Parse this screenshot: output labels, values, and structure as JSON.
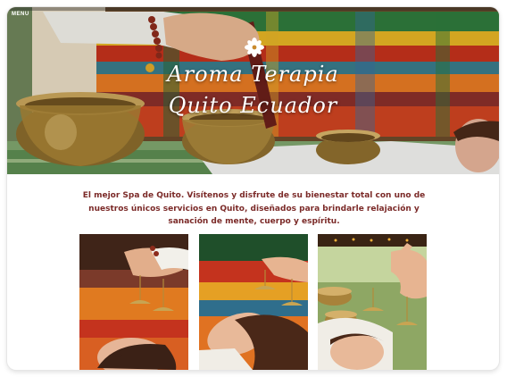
{
  "nav": {
    "menu_label": "MENU"
  },
  "hero": {
    "title_line1": "Aroma Terapia",
    "title_line2": "Quito Ecuador",
    "logo_icon": "flower-icon"
  },
  "intro": {
    "text": "El mejor Spa de Quito. Visítenos y disfrute de su bienestar total con uno de nuestros únicos servicios en Quito, diseñados para brindarle relajación y sanación de mente, cuerpo y espíritu."
  },
  "colors": {
    "text_accent": "#7b2a28",
    "title_text": "#ffffff"
  }
}
